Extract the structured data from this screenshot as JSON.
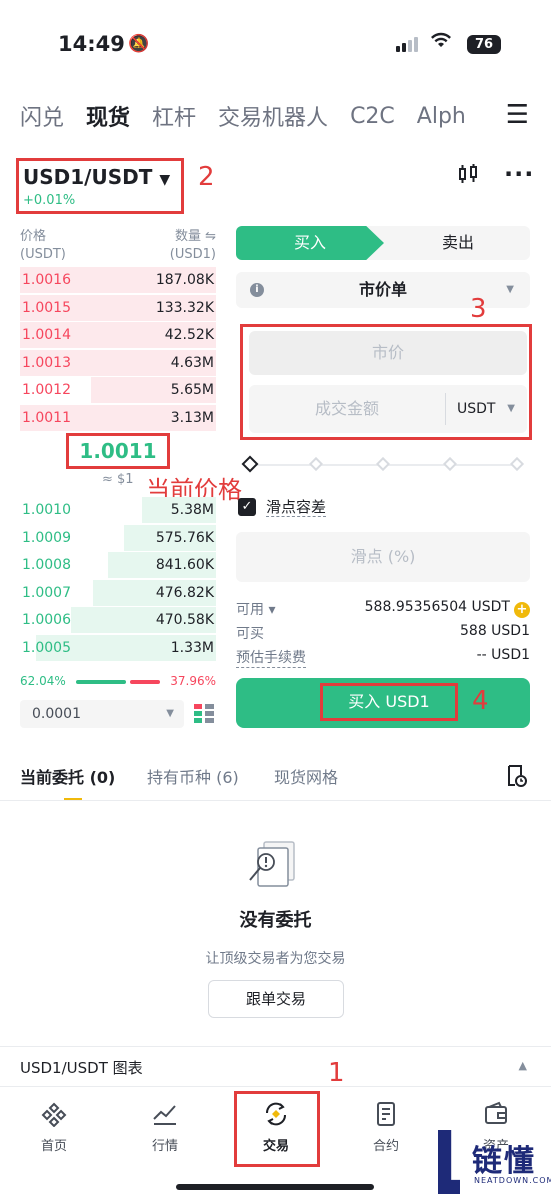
{
  "status_bar": {
    "time": "14:49",
    "battery": "76"
  },
  "top_tabs": [
    "闪兑",
    "现货",
    "杠杆",
    "交易机器人",
    "C2C",
    "Alph"
  ],
  "top_tabs_active": 1,
  "pair": {
    "name": "USD1/USDT",
    "change": "+0.01%"
  },
  "annotations": {
    "n1": "1",
    "n2": "2",
    "n3": "3",
    "n4": "4",
    "current_price_label": "当前价格"
  },
  "orderbook": {
    "header_left": "价格",
    "header_left_unit": "(USDT)",
    "header_right": "数量 ⇋",
    "header_right_unit": "(USD1)",
    "asks": [
      {
        "price": "1.0016",
        "qty": "187.08K",
        "depth": 1.0
      },
      {
        "price": "1.0015",
        "qty": "133.32K",
        "depth": 1.0
      },
      {
        "price": "1.0014",
        "qty": "42.52K",
        "depth": 1.0
      },
      {
        "price": "1.0013",
        "qty": "4.63M",
        "depth": 1.0
      },
      {
        "price": "1.0012",
        "qty": "5.65M",
        "depth": 0.64
      },
      {
        "price": "1.0011",
        "qty": "3.13M",
        "depth": 1.0
      }
    ],
    "current_price": "1.0011",
    "current_usd": "≈ $1",
    "bids": [
      {
        "price": "1.0010",
        "qty": "5.38M",
        "depth": 0.38
      },
      {
        "price": "1.0009",
        "qty": "575.76K",
        "depth": 0.47
      },
      {
        "price": "1.0008",
        "qty": "841.60K",
        "depth": 0.55
      },
      {
        "price": "1.0007",
        "qty": "476.82K",
        "depth": 0.63
      },
      {
        "price": "1.0006",
        "qty": "470.58K",
        "depth": 0.74
      },
      {
        "price": "1.0005",
        "qty": "1.33M",
        "depth": 0.92
      }
    ],
    "buy_ratio": "62.04%",
    "sell_ratio": "37.96%",
    "buy_ratio_value": 0.6204,
    "precision": "0.0001"
  },
  "trade_panel": {
    "buy_tab": "买入",
    "sell_tab": "卖出",
    "order_type": "市价单",
    "price_placeholder": "市价",
    "amount_placeholder": "成交金额",
    "amount_unit": "USDT",
    "slippage_label": "滑点容差",
    "slippage_placeholder": "滑点 (%)",
    "available_label": "可用 ▾",
    "available_value": "588.95356504 USDT",
    "can_buy_label": "可买",
    "can_buy_value": "588 USD1",
    "fee_label": "预估手续费",
    "fee_value": "-- USD1",
    "buy_button": "买入 USD1"
  },
  "order_tabs": [
    "当前委托 (0)",
    "持有币种 (6)",
    "现货网格"
  ],
  "empty_state": {
    "title": "没有委托",
    "subtitle": "让顶级交易者为您交易",
    "button": "跟单交易"
  },
  "chart_bar": {
    "title": "USD1/USDT 图表"
  },
  "bottom_nav": [
    "首页",
    "行情",
    "交易",
    "合约",
    "资产"
  ],
  "watermark": {
    "cn": "链懂",
    "en": "NEATDOWN.COM"
  },
  "colors": {
    "green": "#2ebd85",
    "red": "#f6465d",
    "accent": "#f0b90b",
    "annotation": "#e23c3c"
  }
}
